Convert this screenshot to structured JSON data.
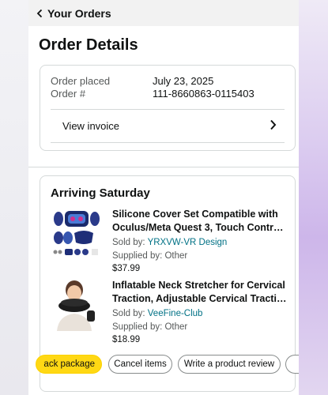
{
  "header": {
    "back_label": "Your Orders"
  },
  "page_title": "Order Details",
  "order": {
    "placed_label": "Order placed",
    "placed_value": "July 23, 2025",
    "number_label": "Order #",
    "number_value": "111-8660863-0115403",
    "invoice_label": "View invoice"
  },
  "shipment": {
    "status": "Arriving Saturday",
    "items": [
      {
        "title_line1": "Silicone Cover Set Compatible with",
        "title_line2": "Oculus/Meta Quest 3, Touch Contr…",
        "sold_by_label": "Sold by:",
        "seller": "YRXVW-VR Design",
        "supplied_by": "Supplied by: Other",
        "price": "$37.99"
      },
      {
        "title_line1": "Inflatable Neck Stretcher for Cervical",
        "title_line2": "Traction, Adjustable Cervical Tracti…",
        "sold_by_label": "Sold by:",
        "seller": "VeeFine-Club",
        "supplied_by": "Supplied by: Other",
        "price": "$18.99"
      }
    ],
    "actions": {
      "track": "ack package",
      "cancel": "Cancel items",
      "review": "Write a product review"
    }
  },
  "colors": {
    "primary_button": "#ffd814",
    "link": "#007185",
    "border": "#d5d9d9"
  }
}
